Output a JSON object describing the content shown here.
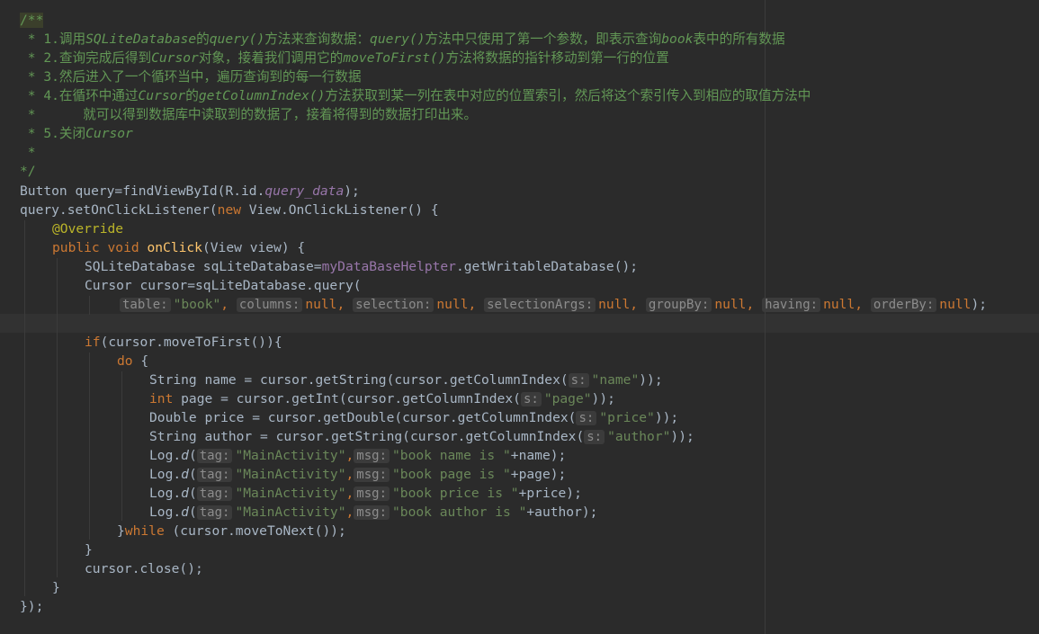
{
  "editor": {
    "comment": {
      "open": "/**",
      "l1_a": " * 1.调用",
      "l1_b": "SQLiteDatabase",
      "l1_c": "的",
      "l1_d": "query()",
      "l1_e": "方法来查询数据：",
      "l1_f": "query()",
      "l1_g": "方法中只使用了第一个参数，即表示查询",
      "l1_h": "book",
      "l1_i": "表中的所有数据",
      "l2_a": " * 2.查询完成后得到",
      "l2_b": "Cursor",
      "l2_c": "对象，接着我们调用它的",
      "l2_d": "moveToFirst()",
      "l2_e": "方法将数据的指针移动到第一行的位置",
      "l3": " * 3.然后进入了一个循环当中，遍历查询到的每一行数据",
      "l4_a": " * 4.在循环中通过",
      "l4_b": "Cursor",
      "l4_c": "的",
      "l4_d": "getColumnIndex()",
      "l4_e": "方法获取到某一列在表中对应的位置索引，然后将这个索引传入到相应的取值方法中",
      "l5": " *      就可以得到数据库中读取到的数据了，接着将得到的数据打印出来。",
      "l6_a": " * 5.关闭",
      "l6_b": "Cursor",
      "l7": " *",
      "close": "*/"
    },
    "code": {
      "button_decl": "Button query=findViewById(R.id.",
      "query_data": "query_data",
      "paren_semi": ");",
      "set_listener": "query.setOnClickListener(",
      "new_kw": "new",
      "listener_type": " View.OnClickListener() {",
      "override": "@Override",
      "public_kw": "public",
      "void_kw": "void",
      "onclick": "onClick",
      "onclick_args": "(View view) {",
      "db_decl": "SQLiteDatabase sqLiteDatabase=",
      "helper_field": "myDataBaseHelpter",
      "get_writable": ".getWritableDatabase();",
      "cursor_decl": "Cursor cursor=sqLiteDatabase.query(",
      "hint_table": "table:",
      "val_book": "\"book\"",
      "hint_columns": "columns:",
      "hint_selection": "selection:",
      "hint_selargs": "selectionArgs:",
      "hint_groupby": "groupBy:",
      "hint_having": "having:",
      "hint_orderby": "orderBy:",
      "null_kw": "null",
      "comma": ",",
      "end_query": ");",
      "if_kw": "if",
      "if_cond": "(cursor.moveToFirst()){",
      "do_kw": "do",
      "do_brace": " {",
      "name_line_a": "String name = cursor.getString(cursor.getColumnIndex(",
      "hint_s": "s:",
      "str_name": "\"name\"",
      "end_twoparen": "));",
      "int_kw": "int",
      "page_line_a": " page = cursor.getInt(cursor.getColumnIndex(",
      "str_page": "\"page\"",
      "price_line_a": "Double price = cursor.getDouble(cursor.getColumnIndex(",
      "str_price": "\"price\"",
      "author_line_a": "String author = cursor.getString(cursor.getColumnIndex(",
      "str_author": "\"author\"",
      "log_a": "Log.",
      "log_d": "d",
      "open_paren": "(",
      "hint_tag": "tag:",
      "str_main": "\"MainActivity\"",
      "hint_msg": "msg:",
      "str_bookname": "\"book name is \"",
      "plus_name": "+name);",
      "str_bookpage": "\"book page is \"",
      "plus_page": "+page);",
      "str_bookprice": "\"book price is \"",
      "plus_price": "+price);",
      "str_bookauthor": "\"book author is \"",
      "plus_author": "+author);",
      "while_close": "}",
      "while_kw": "while",
      "while_cond": " (cursor.moveToNext());",
      "brace": "}",
      "cursor_close": "cursor.close();",
      "end_listener": "});"
    }
  }
}
